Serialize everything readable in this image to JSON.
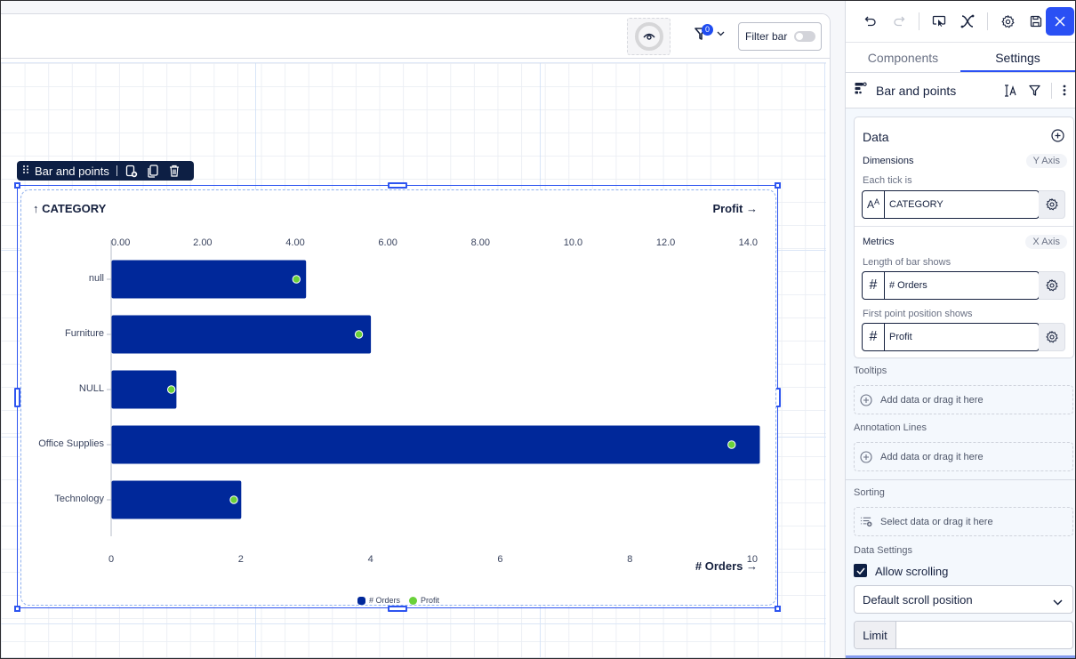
{
  "topbar": {
    "view_icon": "eye-icon",
    "filter_count": "0",
    "filter_bar_label": "Filter bar",
    "filter_bar_enabled": false
  },
  "widget": {
    "toolbar_label": "Bar and points",
    "toolbar_icons": [
      "drag-handle-icon",
      "duplicate-to-icon",
      "copy-icon",
      "trash-icon"
    ]
  },
  "chart_data": {
    "type": "bar",
    "title": "",
    "categories": [
      "null",
      "Furniture",
      "NULL",
      "Office Supplies",
      "Technology"
    ],
    "y_axis_title": "↑ CATEGORY",
    "series": [
      {
        "name": "# Orders",
        "mark": "bar",
        "axis": "bottom",
        "color": "#00289a",
        "values": [
          3,
          4,
          1,
          10,
          2
        ]
      },
      {
        "name": "Profit",
        "mark": "point",
        "axis": "top",
        "color": "#6ad13a",
        "values": [
          4.0,
          5.35,
          1.3,
          13.4,
          2.65
        ]
      }
    ],
    "bottom_axis": {
      "title": "# Orders →",
      "range": [
        0,
        10
      ],
      "ticks": [
        "0",
        "2",
        "4",
        "6",
        "8",
        "10"
      ]
    },
    "top_axis": {
      "title": "Profit →",
      "range": [
        0,
        14
      ],
      "ticks": [
        "0.00",
        "2.00",
        "4.00",
        "6.00",
        "8.00",
        "10.0",
        "12.0",
        "14.0"
      ]
    },
    "legend": [
      {
        "label": "# Orders",
        "color": "#00289a"
      },
      {
        "label": "Profit",
        "color": "#6ad13a"
      }
    ],
    "legend_position": "bottom-center",
    "grid": false
  },
  "panel": {
    "toolbar_icons": [
      "undo-icon",
      "redo-icon",
      "present-icon",
      "variables-icon",
      "settings-icon",
      "save-icon",
      "close-icon"
    ],
    "tabs": [
      {
        "label": "Components",
        "active": false
      },
      {
        "label": "Settings",
        "active": true
      }
    ],
    "component_title": "Bar and points",
    "data": {
      "title": "Data",
      "dimensions_label": "Dimensions",
      "dimensions_axis": "Y Axis",
      "each_tick_label": "Each tick is",
      "dimension_field": "CATEGORY",
      "metrics_label": "Metrics",
      "metrics_axis": "X Axis",
      "bar_length_label": "Length of bar shows",
      "bar_field": "# Orders",
      "point_label": "First point position shows",
      "point_field": "Profit"
    },
    "tooltips": {
      "label": "Tooltips",
      "placeholder": "Add data or drag it here"
    },
    "annotation_lines": {
      "label": "Annotation Lines",
      "placeholder": "Add data or drag it here"
    },
    "sorting": {
      "label": "Sorting",
      "placeholder": "Select data or drag it here"
    },
    "data_settings": {
      "label": "Data Settings",
      "allow_scrolling_label": "Allow scrolling",
      "allow_scrolling": true,
      "scroll_position": "Default scroll position",
      "limit_label": "Limit",
      "limit_value": ""
    }
  }
}
